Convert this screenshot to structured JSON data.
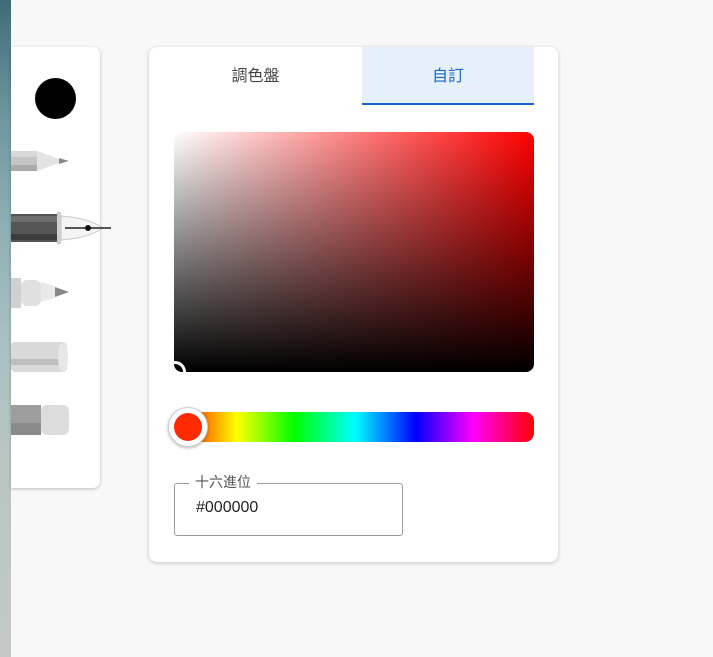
{
  "tools": {
    "current_color": "#000000",
    "items": [
      "pencil-icon",
      "fountain-pen-icon",
      "marker-icon",
      "highlighter-icon",
      "eraser-icon"
    ]
  },
  "picker": {
    "tabs": [
      {
        "label": "調色盤",
        "selected": false
      },
      {
        "label": "自訂",
        "selected": true
      }
    ],
    "hue_color": "#ff2a00",
    "hex": {
      "label": "十六進位",
      "value": "#000000"
    }
  },
  "colors": {
    "accent": "#1a66c9",
    "tab_selected_bg": "#e6f0fc"
  }
}
